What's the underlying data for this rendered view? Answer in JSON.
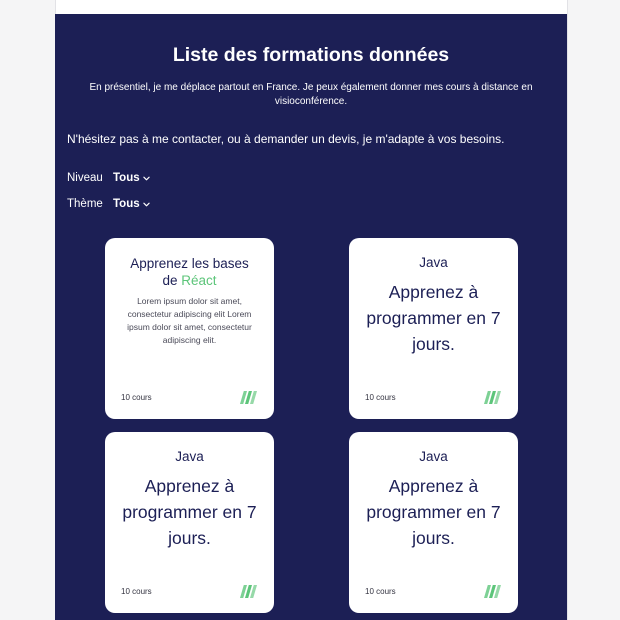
{
  "page": {
    "title": "Liste des formations données",
    "intro": "En présentiel, je me déplace partout en France. Je peux également donner mes cours à distance en visioconférence.",
    "contact_note": "N'hésitez pas à me contacter, ou à demander un devis, je m'adapte à vos besoins."
  },
  "filters": [
    {
      "label": "Niveau",
      "value": "Tous",
      "icon": "chevron-down-icon"
    },
    {
      "label": "Thème",
      "value": "Tous",
      "icon": "chevron-down-icon"
    }
  ],
  "courses": [
    {
      "title": "Apprenez les bases de",
      "highlight": "Réact",
      "description": "Lorem ipsum dolor sit amet, consectetur adipiscing elit Lorem ipsum dolor sit amet, consectetur adipiscing elit.",
      "count": "10 cours",
      "icon": "stripes-icon"
    },
    {
      "category": "Java",
      "title": "Apprenez à programmer en 7 jours.",
      "count": "10 cours",
      "icon": "stripes-icon"
    },
    {
      "category": "Java",
      "title": "Apprenez à programmer en 7 jours.",
      "count": "10 cours",
      "icon": "stripes-icon"
    },
    {
      "category": "Java",
      "title": "Apprenez à programmer en 7 jours.",
      "count": "10 cours",
      "icon": "stripes-icon"
    }
  ],
  "colors": {
    "panel_background": "#1c1f55",
    "card_background": "#ffffff",
    "accent": "#5dc57a",
    "text_dark": "#1c1f55"
  }
}
